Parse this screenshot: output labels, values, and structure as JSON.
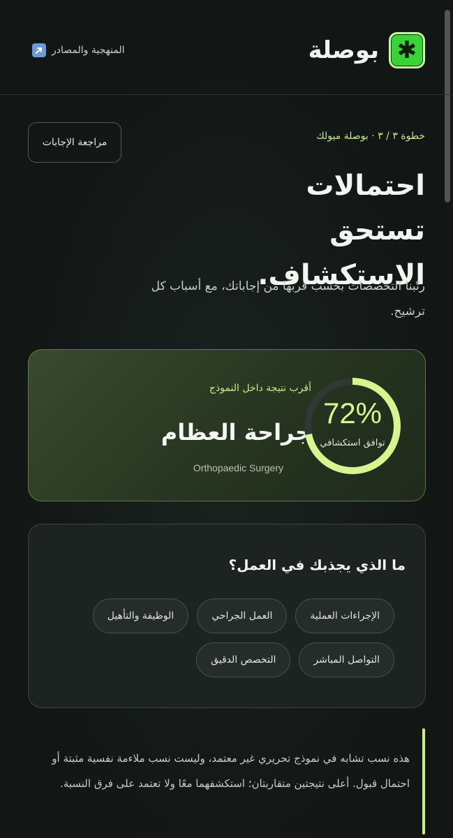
{
  "header": {
    "brand_name": "بوصلة",
    "brand_icon": "asterisk-icon",
    "method_link": "المنهجية والمصادر",
    "method_icon": "external-link-icon"
  },
  "intro": {
    "step": "خطوة ٣ / ٣ · بوصلة ميولك",
    "review_button": "مراجعة الإجابات",
    "title": "احتمالات تستحق الاستكشاف.",
    "subtitle": "رتّبنا التخصصات بحسب قربها من إجاباتك، مع أسباب كل ترشيح."
  },
  "result": {
    "kicker": "أقرب نتيجة داخل النموذج",
    "name_ar": "جراحة العظام",
    "name_en": "Orthopaedic Surgery",
    "match_percent": 72,
    "match_display": "72%",
    "match_label": "توافق استكشافي"
  },
  "attraction": {
    "title": "ما الذي يجذبك في العمل؟",
    "chips": [
      "الإجراءات العملية",
      "العمل الجراحي",
      "الوظيفة والتأهيل",
      "التواصل المباشر",
      "التخصص الدقيق"
    ]
  },
  "note": {
    "text": "هذه نسب تشابه في نموذج تحريري غير معتمد، وليست نسب ملاءمة نفسية مثبتة أو احتمال قبول. أعلى نتيجتين متقاربتان؛ استكشفهما معًا ولا تعتمد على فرق النسبة."
  },
  "colors": {
    "accent": "#c6f27a",
    "ring_track": "#2f3832",
    "brand_green": "#38d437"
  }
}
